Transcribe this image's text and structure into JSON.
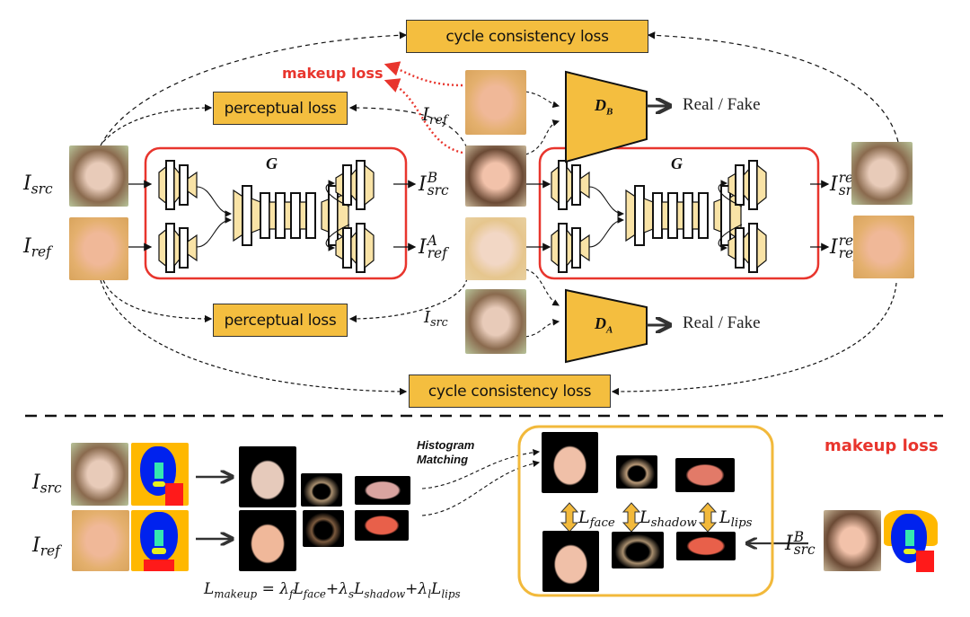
{
  "figure": {
    "top": {
      "cycle_loss_top": "cycle consistency loss",
      "cycle_loss_bottom": "cycle consistency loss",
      "perceptual_loss_top": "perceptual loss",
      "perceptual_loss_bottom": "perceptual loss",
      "makeup_loss_label": "makeup loss",
      "generator_label_1": "G",
      "generator_label_2": "G",
      "discriminator_b": "D",
      "discriminator_b_sub": "B",
      "discriminator_a": "D",
      "discriminator_a_sub": "A",
      "real_fake_b": "Real / Fake",
      "real_fake_a": "Real / Fake",
      "labels": {
        "i_src_input": {
          "base": "I",
          "sub": "src"
        },
        "i_ref_input": {
          "base": "I",
          "sub": "ref"
        },
        "i_src_b": {
          "base": "I",
          "sup": "B",
          "sub": "src"
        },
        "i_ref_a": {
          "base": "I",
          "sup": "A",
          "sub": "ref"
        },
        "i_ref_disc": {
          "base": "I",
          "sub": "ref"
        },
        "i_src_disc": {
          "base": "I",
          "sub": "src"
        },
        "i_src_rec": {
          "base": "I",
          "sup": "rec",
          "sub": "src"
        },
        "i_ref_rec": {
          "base": "I",
          "sup": "rec",
          "sub": "ref"
        }
      }
    },
    "bottom": {
      "histogram_line1": "Histogram",
      "histogram_line2": "Matching",
      "makeup_loss_title": "makeup loss",
      "labels": {
        "i_src": {
          "base": "I",
          "sub": "src"
        },
        "i_ref": {
          "base": "I",
          "sub": "ref"
        },
        "i_src_b": {
          "base": "I",
          "sup": "B",
          "sub": "src"
        },
        "l_face": {
          "base": "L",
          "sub": "face"
        },
        "l_shadow": {
          "base": "L",
          "sub": "shadow"
        },
        "l_lips": {
          "base": "L",
          "sub": "lips"
        }
      },
      "formula": {
        "lhs": "L",
        "lhs_sub": "makeup",
        "eq": " = ",
        "t1_coef": "λ",
        "t1_coef_sub": "f",
        "t1": "L",
        "t1_sub": "face",
        "plus1": "+",
        "t2_coef": "λ",
        "t2_coef_sub": "s",
        "t2": "L",
        "t2_sub": "shadow",
        "plus2": "+",
        "t3_coef": "λ",
        "t3_coef_sub": "l",
        "t3": "L",
        "t3_sub": "lips"
      }
    },
    "colors": {
      "loss_box": "#f4be3f",
      "generator_border": "#e8352d",
      "makeup_red": "#e8352d",
      "block_fill": "#f9e3a6",
      "makeup_panel_border": "#f2b93b"
    }
  }
}
